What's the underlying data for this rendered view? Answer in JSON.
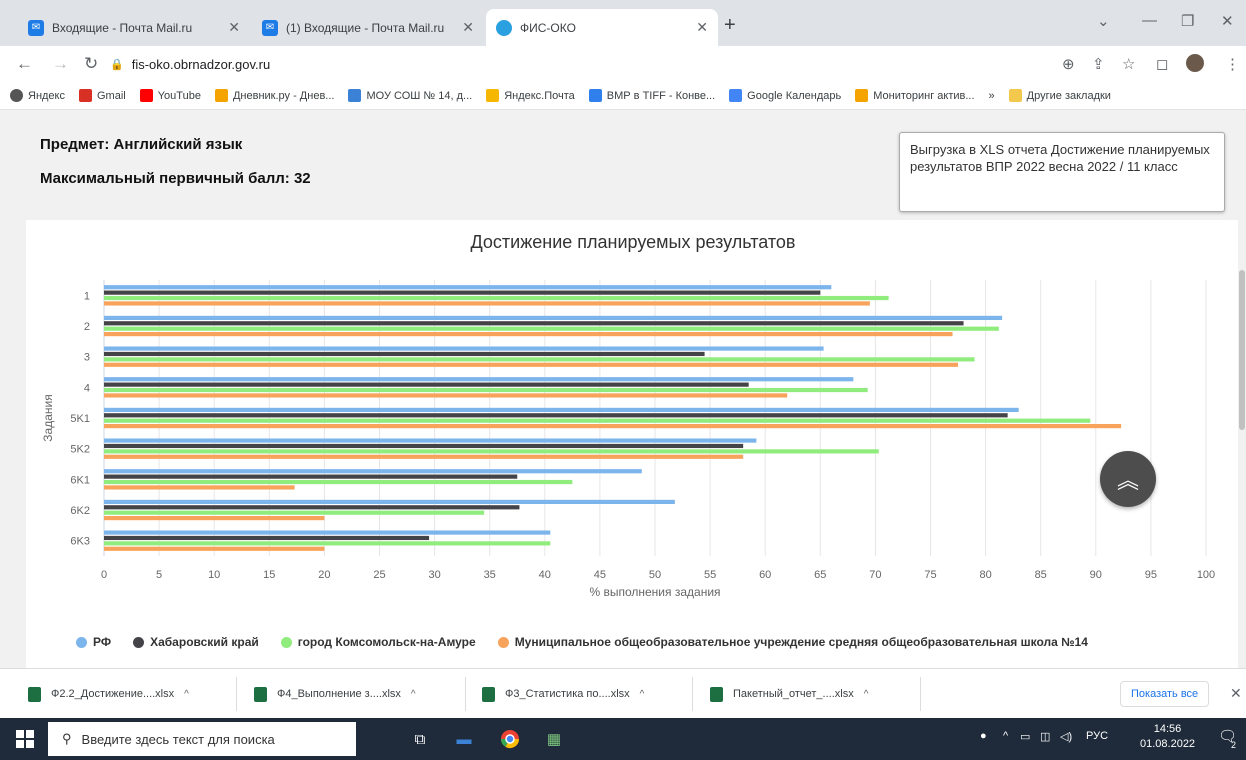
{
  "browser": {
    "tabs": [
      {
        "title": "Входящие - Почта Mail.ru",
        "icon": "mail-icon",
        "active": false
      },
      {
        "title": "(1) Входящие - Почта Mail.ru",
        "icon": "mail-icon",
        "active": false
      },
      {
        "title": "ФИС-ОКО",
        "icon": "fis-oko-icon",
        "active": true
      }
    ],
    "new_tab": "+",
    "url": "fis-oko.obrnadzor.gov.ru",
    "bookmarks": [
      {
        "label": "Яндекс",
        "color": "#555555"
      },
      {
        "label": "Gmail",
        "color": "#d93025"
      },
      {
        "label": "YouTube",
        "color": "#ff0000"
      },
      {
        "label": "Дневник.ру - Днев...",
        "color": "#f4a300"
      },
      {
        "label": "МОУ СОШ № 14, д...",
        "color": "#3b82d6"
      },
      {
        "label": "Яндекс.Почта",
        "color": "#f5b700"
      },
      {
        "label": "ВМР в TIFF - Конве...",
        "color": "#2f80ed"
      },
      {
        "label": "Google Календарь",
        "color": "#4285f4"
      },
      {
        "label": "Мониторинг актив...",
        "color": "#f4a300"
      }
    ],
    "bookmarks_more": "»",
    "other_bookmarks": "Другие закладки"
  },
  "page": {
    "subject": "Предмет: Английский язык",
    "max_score": "Максимальный первичный балл: 32",
    "tooltip": "Выгрузка в XLS отчета Достижение планируемых результатов ВПР 2022 весна 2022 / 11 класс"
  },
  "chart_data": {
    "type": "bar",
    "orientation": "horizontal",
    "title": "Достижение планируемых результатов",
    "xlabel": "% выполнения задания",
    "ylabel": "Задания",
    "xlim": [
      0,
      100
    ],
    "xticks": [
      0,
      5,
      10,
      15,
      20,
      25,
      30,
      35,
      40,
      45,
      50,
      55,
      60,
      65,
      70,
      75,
      80,
      85,
      90,
      95,
      100
    ],
    "categories": [
      "1",
      "2",
      "3",
      "4",
      "5K1",
      "5K2",
      "6K1",
      "6K2",
      "6K3"
    ],
    "series": [
      {
        "name": "РФ",
        "color": "#7cb5ec",
        "values": [
          66,
          81.5,
          65.3,
          68,
          83,
          59.2,
          48.8,
          51.8,
          40.5
        ]
      },
      {
        "name": "Хабаровский край",
        "color": "#434348",
        "values": [
          65,
          78,
          54.5,
          58.5,
          82,
          58,
          37.5,
          37.7,
          29.5
        ]
      },
      {
        "name": "город Комсомольск-на-Амуре",
        "color": "#90ed7d",
        "values": [
          71.2,
          81.2,
          79,
          69.3,
          89.5,
          70.3,
          42.5,
          34.5,
          40.5
        ]
      },
      {
        "name": "Муниципальное общеобразовательное учреждение средняя общеобразовательная школа №14",
        "color": "#f7a35c",
        "values": [
          69.5,
          77,
          77.5,
          62,
          92.3,
          58,
          17.3,
          20,
          20
        ]
      }
    ],
    "grid": true,
    "legend_position": "bottom"
  },
  "downloads": {
    "items": [
      {
        "name": "Ф2.2_Достижение....xlsx"
      },
      {
        "name": "Ф4_Выполнение з....xlsx"
      },
      {
        "name": "Ф3_Статистика по....xlsx"
      },
      {
        "name": "Пакетный_отчет_....xlsx"
      }
    ],
    "show_all": "Показать все"
  },
  "taskbar": {
    "search_placeholder": "Введите здесь текст для поиска",
    "lang": "РУС",
    "time": "14:56",
    "date": "01.08.2022",
    "notification_count": "2"
  }
}
